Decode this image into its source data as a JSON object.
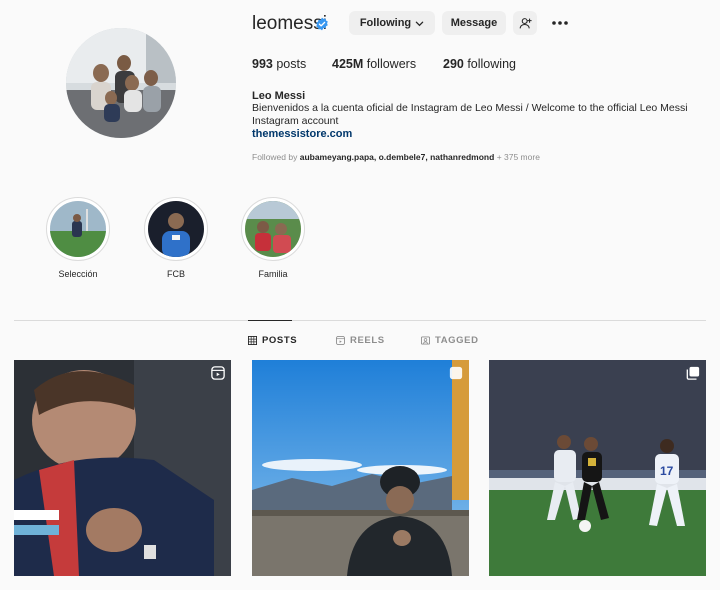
{
  "profile": {
    "username": "leomessi",
    "full_name": "Leo Messi",
    "bio": "Bienvenidos a la cuenta oficial de Instagram de Leo Messi / Welcome to the official Leo Messi Instagram account",
    "link": "themessistore.com",
    "followed_by_prefix": "Followed by ",
    "followed_by_names": "aubameyang.papa, o.dembele7, nathanredmond",
    "followed_by_more": " + 375 more"
  },
  "buttons": {
    "following": "Following",
    "message": "Message"
  },
  "stats": {
    "posts_value": "993",
    "posts_label": " posts",
    "followers_value": "425M",
    "followers_label": " followers",
    "following_value": "290",
    "following_label": " following"
  },
  "highlights": [
    {
      "label": "Selección"
    },
    {
      "label": "FCB"
    },
    {
      "label": "Familia"
    }
  ],
  "tabs": [
    {
      "label": "POSTS",
      "active": true
    },
    {
      "label": "REELS",
      "active": false
    },
    {
      "label": "TAGGED",
      "active": false
    }
  ],
  "icons": {
    "verified": "verified-badge-icon",
    "chevron": "chevron-down-icon",
    "add_user": "add-user-icon",
    "more": "more-options-icon",
    "posts_tab": "grid-icon",
    "reels_tab": "reels-icon",
    "tagged_tab": "tagged-icon"
  },
  "colors": {
    "link": "#00376b",
    "verified": "#3897f0",
    "muted": "#8e8e8e"
  }
}
